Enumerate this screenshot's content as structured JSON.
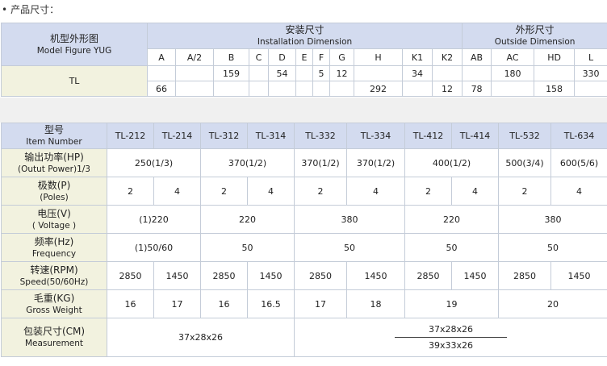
{
  "heading": {
    "bullet": "•",
    "text": "产品尺寸："
  },
  "dimensions": {
    "model_figure_cn": "机型外形图",
    "model_figure_en": "Model Figure YUG",
    "install_cn": "安装尺寸",
    "install_en": "Installation Dimension",
    "outside_cn": "外形尺寸",
    "outside_en": "Outside Dimension",
    "columns": [
      "A",
      "A/2",
      "B",
      "C",
      "D",
      "E",
      "F",
      "G",
      "H",
      "K1",
      "K2",
      "AB",
      "AC",
      "HD",
      "L"
    ],
    "model": "TL",
    "row1": [
      "",
      "",
      "159",
      "",
      "54",
      "",
      "5",
      "12",
      "",
      "34",
      "",
      "",
      "180",
      "",
      "330"
    ],
    "row2": [
      "66",
      "",
      "",
      "",
      "",
      "",
      "",
      "",
      "292",
      "",
      "12",
      "78",
      "",
      "158",
      ""
    ]
  },
  "specs": {
    "item_cn": "型号",
    "item_en": "Item Number",
    "models": [
      "TL-212",
      "TL-214",
      "TL-312",
      "TL-314",
      "TL-332",
      "TL-334",
      "TL-412",
      "TL-414",
      "TL-532",
      "TL-634"
    ],
    "power_cn": "输出功率(HP)",
    "power_en": "(Outut Power)1/3",
    "power": [
      "250(1/3)",
      "370(1/2)",
      "370(1/2)",
      "370(1/2)",
      "400(1/2)",
      "500(3/4)",
      "600(5/6)"
    ],
    "poles_cn": "极数(P)",
    "poles_en": "(Poles)",
    "poles": [
      "2",
      "4",
      "2",
      "4",
      "2",
      "4",
      "2",
      "4",
      "2",
      "4"
    ],
    "voltage_cn": "电压(V)",
    "voltage_en": "( Voltage )",
    "voltage": [
      "(1)220",
      "220",
      "380",
      "220",
      "380"
    ],
    "freq_cn": "频率(Hz)",
    "freq_en": "Frequency",
    "freq": [
      "(1)50/60",
      "50",
      "50",
      "50",
      "50"
    ],
    "speed_cn": "转速(RPM)",
    "speed_en": "Speed(50/60Hz)",
    "speed": [
      "2850",
      "1450",
      "2850",
      "1450",
      "2850",
      "1450",
      "2850",
      "1450",
      "2850",
      "1450"
    ],
    "weight_cn": "毛重(KG)",
    "weight_en": "Gross Weight",
    "weight": [
      "16",
      "17",
      "16",
      "16.5",
      "17",
      "18",
      "19",
      "20"
    ],
    "measure_cn": "包装尺寸(CM)",
    "measure_en": "Measurement",
    "measure_left": "37x28x26",
    "measure_right_top": "37x28x26",
    "measure_right_bottom": "39x33x26"
  }
}
